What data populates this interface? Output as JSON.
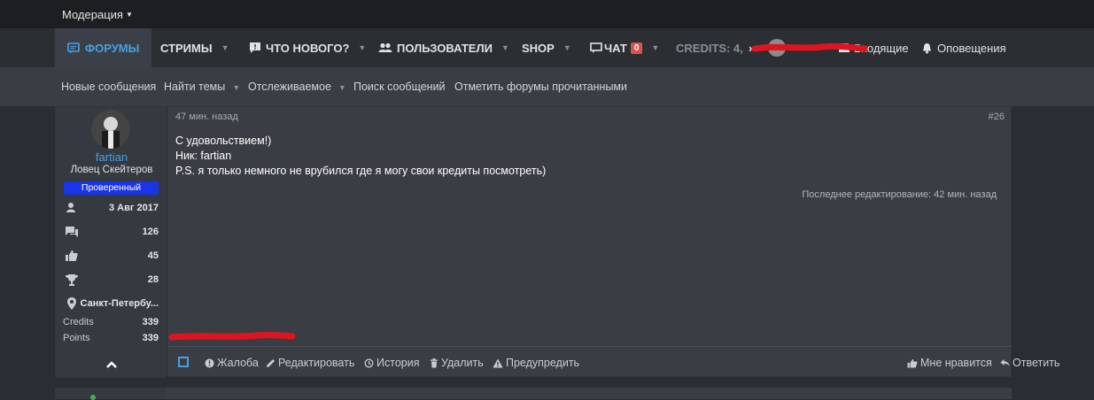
{
  "topbar": {
    "moderation": "Модерация"
  },
  "nav": {
    "forums": "ФОРУМЫ",
    "streams": "СТРИМЫ",
    "whats_new": "ЧТО НОВОГО?",
    "users": "ПОЛЬЗОВАТЕЛИ",
    "shop": "SHOP",
    "chat": "ЧАТ",
    "chat_count": "0",
    "credits": "CREDITS: 4,",
    "inbox": "Входящие",
    "alerts": "Оповещения"
  },
  "subnav": {
    "new_posts": "Новые сообщения",
    "find_threads": "Найти темы",
    "watched": "Отслеживаемое",
    "search_posts": "Поиск сообщений",
    "mark_read": "Отметить форумы прочитанными"
  },
  "post": {
    "username": "fartian",
    "user_title": "Ловец Скейтеров",
    "banner": "Проверенный",
    "joined": "3 Авг 2017",
    "messages": "126",
    "likes": "45",
    "trophies": "28",
    "location": "Санкт-Петербу...",
    "credits_label": "Credits",
    "credits_value": "339",
    "points_label": "Points",
    "points_value": "339",
    "time": "47 мин. назад",
    "number": "#26",
    "lines": [
      "С удовольствием!)",
      "Ник: fartian",
      "P.S. я только немного не врубился где я могу свои кредиты посмотреть)"
    ],
    "edited": "Последнее редактирование: 42 мин. назад",
    "actions": {
      "report": "Жалоба",
      "edit": "Редактировать",
      "history": "История",
      "delete": "Удалить",
      "warn": "Предупредить",
      "like": "Мне нравится",
      "reply": "Ответить"
    }
  },
  "colors": {
    "accent": "#4a9fe0",
    "banner": "#1a35e8",
    "badge": "#d9534f",
    "scribble": "#e0141e"
  }
}
